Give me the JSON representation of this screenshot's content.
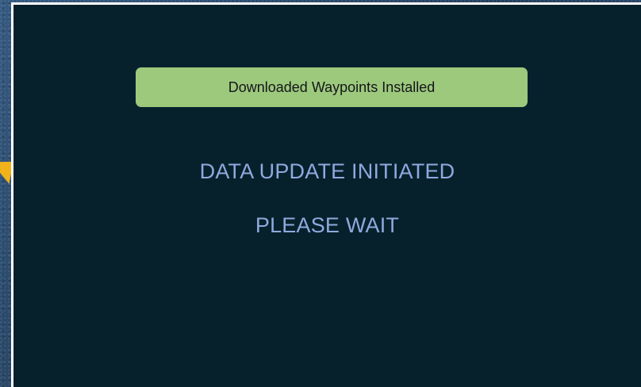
{
  "banner": {
    "text": "Downloaded Waypoints Installed"
  },
  "messages": {
    "line1": "DATA UPDATE INITIATED",
    "line2": "PLEASE WAIT"
  },
  "colors": {
    "screen_background": "#07212c",
    "banner_background": "#9dc97d",
    "message_text": "#8fa9df",
    "callout_arrow": "#f2b21b"
  },
  "icons": {
    "callout": "pointer-arrow-icon"
  }
}
